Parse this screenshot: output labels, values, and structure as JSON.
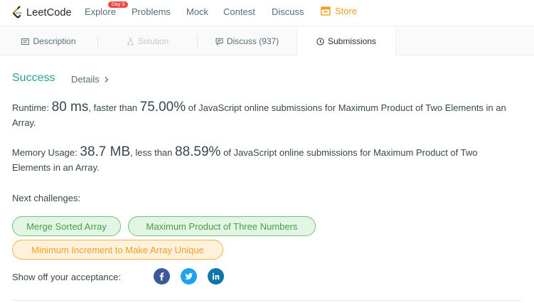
{
  "nav": {
    "logo_text": "LeetCode",
    "explore": "Explore",
    "explore_badge": "Day 3",
    "problems": "Problems",
    "mock": "Mock",
    "contest": "Contest",
    "discuss": "Discuss",
    "store": "Store"
  },
  "tabs": {
    "description": "Description",
    "solution": "Solution",
    "discuss": "Discuss (937)",
    "submissions": "Submissions"
  },
  "result": {
    "status": "Success",
    "details": "Details"
  },
  "runtime": {
    "label": "Runtime: ",
    "value": "80 ms",
    "mid": ", faster than ",
    "percent": "75.00%",
    "suffix": " of JavaScript online submissions for Maximum Product of Two Elements in an Array."
  },
  "memory": {
    "label": "Memory Usage: ",
    "value": "38.7 MB",
    "mid": ", less than ",
    "percent": "88.59%",
    "suffix": " of JavaScript online submissions for Maximum Product of Two Elements in an Array."
  },
  "next": {
    "label": "Next challenges:",
    "items": [
      {
        "title": "Merge Sorted Array",
        "difficulty": "easy"
      },
      {
        "title": "Maximum Product of Three Numbers",
        "difficulty": "easy"
      },
      {
        "title": "Minimum Increment to Make Array Unique",
        "difficulty": "medium"
      }
    ]
  },
  "share": {
    "label": "Show off your acceptance:",
    "icons": [
      "facebook-icon",
      "twitter-icon",
      "linkedin-icon"
    ]
  },
  "colors": {
    "success": "#29a19c",
    "store": "#f0a020",
    "easy_bg": "#e3f6e5",
    "easy_border": "#6cc471",
    "easy_text": "#43a047",
    "medium_bg": "#fff1dc",
    "medium_border": "#f5b13c",
    "medium_text": "#f0a020",
    "facebook": "#3b5998",
    "twitter": "#1da1f2",
    "linkedin": "#0e76a8",
    "badge": "#ef4743"
  }
}
